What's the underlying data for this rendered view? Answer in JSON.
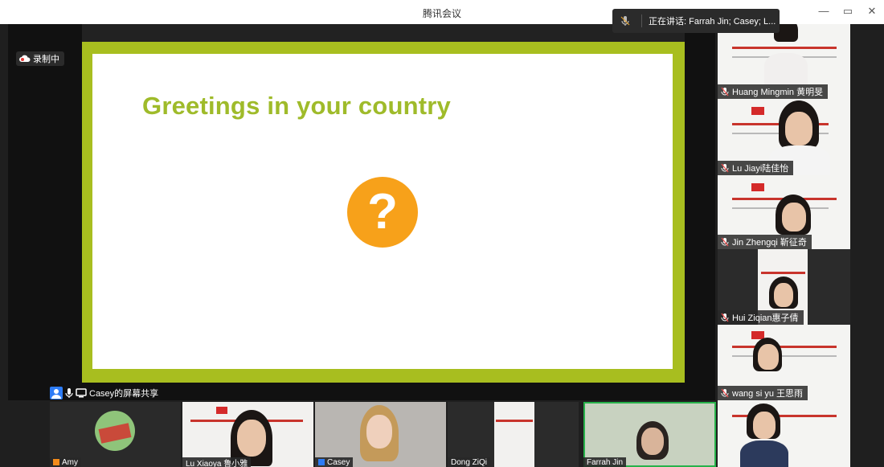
{
  "window": {
    "title": "腾讯会议",
    "minimize": "—",
    "restore": "▭",
    "close": "✕"
  },
  "speaking": {
    "label": "正在讲话:  Farrah Jin; Casey; L..."
  },
  "recording": {
    "label": "录制中"
  },
  "slide": {
    "title": "Greetings in your country",
    "symbol": "?",
    "frame_color": "#a8be1f",
    "title_color": "#9fbb2a",
    "accent_color": "#f7a11a"
  },
  "share": {
    "label": "Casey的屏幕共享"
  },
  "participants_right": [
    {
      "name": "Huang Mingmin 黄明旻"
    },
    {
      "name": "Lu Jiayi陆佳怡"
    },
    {
      "name": "Jin Zhengqi 靳征奇"
    },
    {
      "name": "Hui Ziqian惠子倩"
    },
    {
      "name": "wang si yu 王思雨"
    },
    {
      "name": ""
    }
  ],
  "participants_bottom": [
    {
      "name": "Amy"
    },
    {
      "name": "Lu Xiaoya 鲁小雅"
    },
    {
      "name": "Casey"
    },
    {
      "name": "Dong ZiQi"
    },
    {
      "name": "Farrah Jin"
    }
  ],
  "colors": {
    "active_speaker": "#27b24a",
    "share_icon": "#2d7cf6"
  }
}
